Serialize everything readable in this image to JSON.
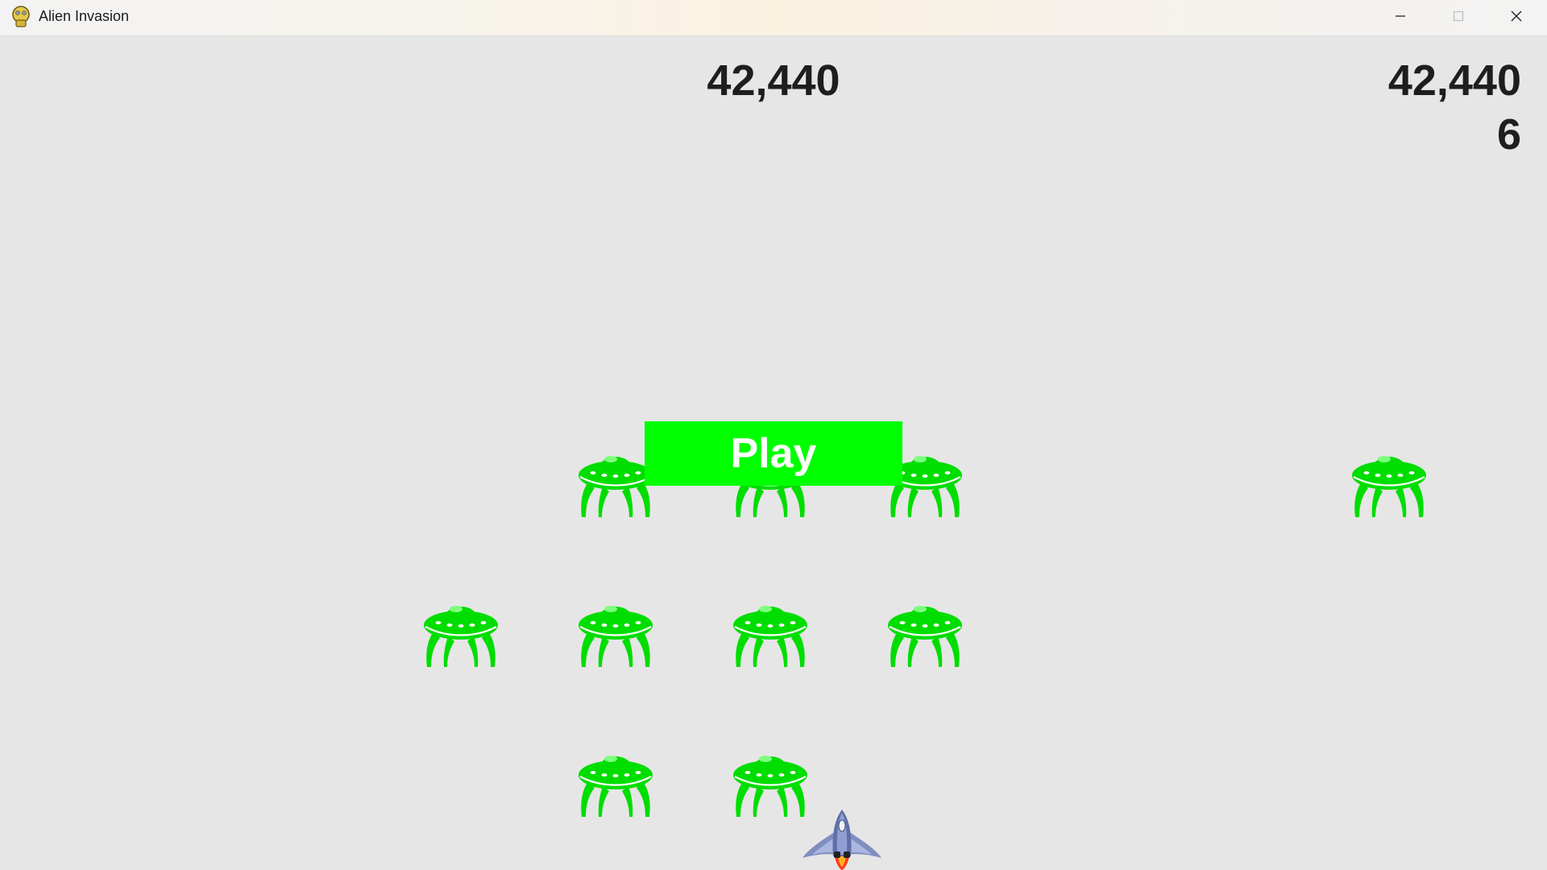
{
  "window": {
    "title": "Alien Invasion",
    "controls": [
      "minimize-icon",
      "maximize-icon",
      "close-icon"
    ]
  },
  "hud": {
    "score": "42,440",
    "high_score": "42,440",
    "level": "6"
  },
  "play_button": {
    "label": "Play",
    "color": "#00ff00",
    "text_color": "#ffffff"
  },
  "game": {
    "background_color": "#e6e6e6",
    "alien_color": "#00dd00",
    "alien_count": 10,
    "ship_icon": "rocket-ship-icon"
  }
}
